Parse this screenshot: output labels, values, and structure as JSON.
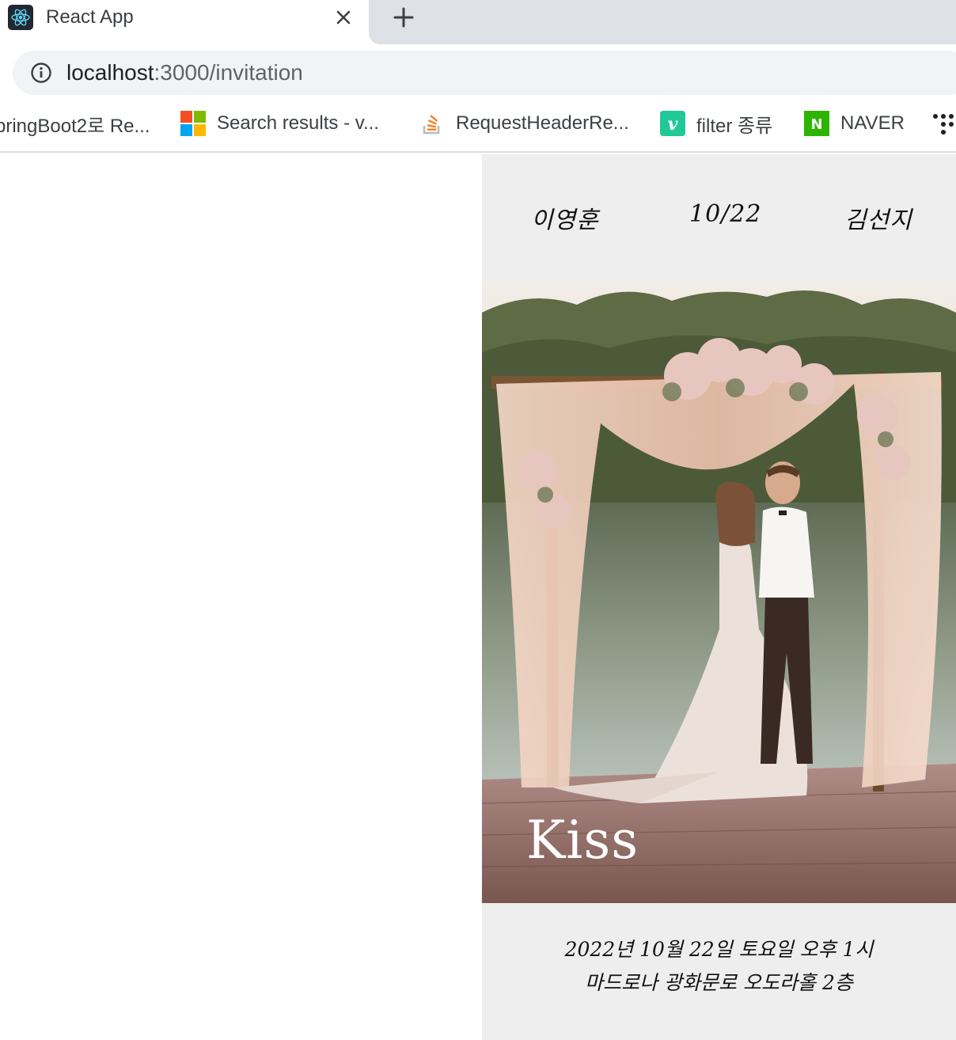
{
  "browser": {
    "tab": {
      "title": "React App",
      "favicon": "react-logo-icon"
    },
    "new_tab_icon": "plus-icon",
    "address": {
      "host": "localhost",
      "path": ":3000/invitation",
      "icon": "info-icon"
    },
    "bookmarks": [
      {
        "label": "pringBoot2로 Re...",
        "icon": "none"
      },
      {
        "label": "Search results - v...",
        "icon": "microsoft-logo-icon"
      },
      {
        "label": "RequestHeaderRe...",
        "icon": "stackoverflow-icon"
      },
      {
        "label": "filter 종류",
        "icon": "velog-icon"
      },
      {
        "label": "NAVER",
        "icon": "naver-icon"
      }
    ],
    "overflow_icon": "more-dots-icon"
  },
  "invitation": {
    "groom": "이영훈",
    "date_short": "10/22",
    "bride": "김선지",
    "photo_caption": "Kiss",
    "details_line1": "2022년 10월 22일 토요일 오후 1시",
    "details_line2": "마드로나 광화문로 오도라홀 2층"
  },
  "colors": {
    "panel_bg": "#eeeeee",
    "tabstrip_bg": "#dee1e6",
    "omnibox_bg": "#f1f3f4"
  }
}
